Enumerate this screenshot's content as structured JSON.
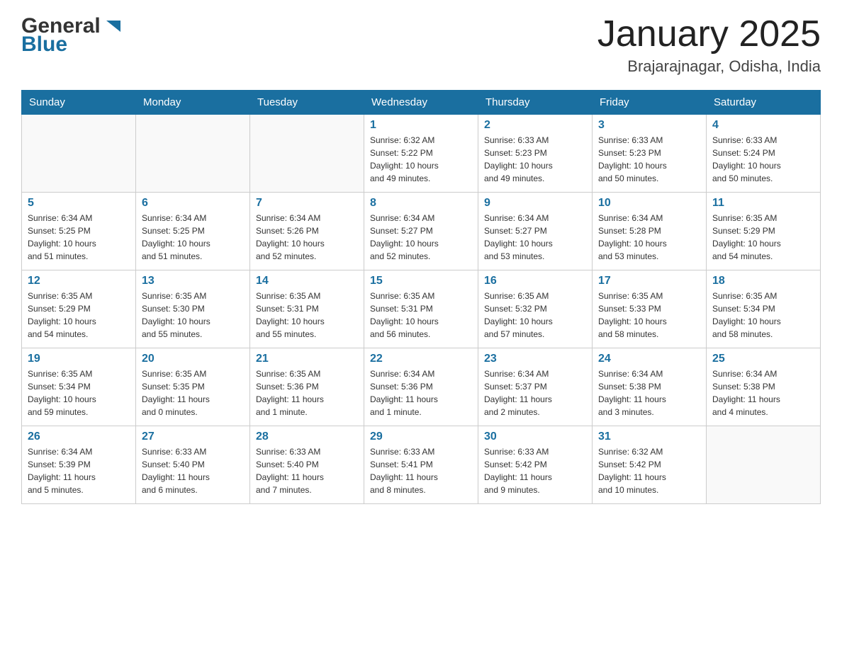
{
  "header": {
    "logo_general": "General",
    "logo_arrow_color": "#1a6fa0",
    "logo_blue": "Blue",
    "month_title": "January 2025",
    "location": "Brajarajnagar, Odisha, India"
  },
  "days_of_week": [
    "Sunday",
    "Monday",
    "Tuesday",
    "Wednesday",
    "Thursday",
    "Friday",
    "Saturday"
  ],
  "weeks": [
    {
      "cells": [
        {
          "day": "",
          "info": ""
        },
        {
          "day": "",
          "info": ""
        },
        {
          "day": "",
          "info": ""
        },
        {
          "day": "1",
          "info": "Sunrise: 6:32 AM\nSunset: 5:22 PM\nDaylight: 10 hours\nand 49 minutes."
        },
        {
          "day": "2",
          "info": "Sunrise: 6:33 AM\nSunset: 5:23 PM\nDaylight: 10 hours\nand 49 minutes."
        },
        {
          "day": "3",
          "info": "Sunrise: 6:33 AM\nSunset: 5:23 PM\nDaylight: 10 hours\nand 50 minutes."
        },
        {
          "day": "4",
          "info": "Sunrise: 6:33 AM\nSunset: 5:24 PM\nDaylight: 10 hours\nand 50 minutes."
        }
      ]
    },
    {
      "cells": [
        {
          "day": "5",
          "info": "Sunrise: 6:34 AM\nSunset: 5:25 PM\nDaylight: 10 hours\nand 51 minutes."
        },
        {
          "day": "6",
          "info": "Sunrise: 6:34 AM\nSunset: 5:25 PM\nDaylight: 10 hours\nand 51 minutes."
        },
        {
          "day": "7",
          "info": "Sunrise: 6:34 AM\nSunset: 5:26 PM\nDaylight: 10 hours\nand 52 minutes."
        },
        {
          "day": "8",
          "info": "Sunrise: 6:34 AM\nSunset: 5:27 PM\nDaylight: 10 hours\nand 52 minutes."
        },
        {
          "day": "9",
          "info": "Sunrise: 6:34 AM\nSunset: 5:27 PM\nDaylight: 10 hours\nand 53 minutes."
        },
        {
          "day": "10",
          "info": "Sunrise: 6:34 AM\nSunset: 5:28 PM\nDaylight: 10 hours\nand 53 minutes."
        },
        {
          "day": "11",
          "info": "Sunrise: 6:35 AM\nSunset: 5:29 PM\nDaylight: 10 hours\nand 54 minutes."
        }
      ]
    },
    {
      "cells": [
        {
          "day": "12",
          "info": "Sunrise: 6:35 AM\nSunset: 5:29 PM\nDaylight: 10 hours\nand 54 minutes."
        },
        {
          "day": "13",
          "info": "Sunrise: 6:35 AM\nSunset: 5:30 PM\nDaylight: 10 hours\nand 55 minutes."
        },
        {
          "day": "14",
          "info": "Sunrise: 6:35 AM\nSunset: 5:31 PM\nDaylight: 10 hours\nand 55 minutes."
        },
        {
          "day": "15",
          "info": "Sunrise: 6:35 AM\nSunset: 5:31 PM\nDaylight: 10 hours\nand 56 minutes."
        },
        {
          "day": "16",
          "info": "Sunrise: 6:35 AM\nSunset: 5:32 PM\nDaylight: 10 hours\nand 57 minutes."
        },
        {
          "day": "17",
          "info": "Sunrise: 6:35 AM\nSunset: 5:33 PM\nDaylight: 10 hours\nand 58 minutes."
        },
        {
          "day": "18",
          "info": "Sunrise: 6:35 AM\nSunset: 5:34 PM\nDaylight: 10 hours\nand 58 minutes."
        }
      ]
    },
    {
      "cells": [
        {
          "day": "19",
          "info": "Sunrise: 6:35 AM\nSunset: 5:34 PM\nDaylight: 10 hours\nand 59 minutes."
        },
        {
          "day": "20",
          "info": "Sunrise: 6:35 AM\nSunset: 5:35 PM\nDaylight: 11 hours\nand 0 minutes."
        },
        {
          "day": "21",
          "info": "Sunrise: 6:35 AM\nSunset: 5:36 PM\nDaylight: 11 hours\nand 1 minute."
        },
        {
          "day": "22",
          "info": "Sunrise: 6:34 AM\nSunset: 5:36 PM\nDaylight: 11 hours\nand 1 minute."
        },
        {
          "day": "23",
          "info": "Sunrise: 6:34 AM\nSunset: 5:37 PM\nDaylight: 11 hours\nand 2 minutes."
        },
        {
          "day": "24",
          "info": "Sunrise: 6:34 AM\nSunset: 5:38 PM\nDaylight: 11 hours\nand 3 minutes."
        },
        {
          "day": "25",
          "info": "Sunrise: 6:34 AM\nSunset: 5:38 PM\nDaylight: 11 hours\nand 4 minutes."
        }
      ]
    },
    {
      "cells": [
        {
          "day": "26",
          "info": "Sunrise: 6:34 AM\nSunset: 5:39 PM\nDaylight: 11 hours\nand 5 minutes."
        },
        {
          "day": "27",
          "info": "Sunrise: 6:33 AM\nSunset: 5:40 PM\nDaylight: 11 hours\nand 6 minutes."
        },
        {
          "day": "28",
          "info": "Sunrise: 6:33 AM\nSunset: 5:40 PM\nDaylight: 11 hours\nand 7 minutes."
        },
        {
          "day": "29",
          "info": "Sunrise: 6:33 AM\nSunset: 5:41 PM\nDaylight: 11 hours\nand 8 minutes."
        },
        {
          "day": "30",
          "info": "Sunrise: 6:33 AM\nSunset: 5:42 PM\nDaylight: 11 hours\nand 9 minutes."
        },
        {
          "day": "31",
          "info": "Sunrise: 6:32 AM\nSunset: 5:42 PM\nDaylight: 11 hours\nand 10 minutes."
        },
        {
          "day": "",
          "info": ""
        }
      ]
    }
  ]
}
